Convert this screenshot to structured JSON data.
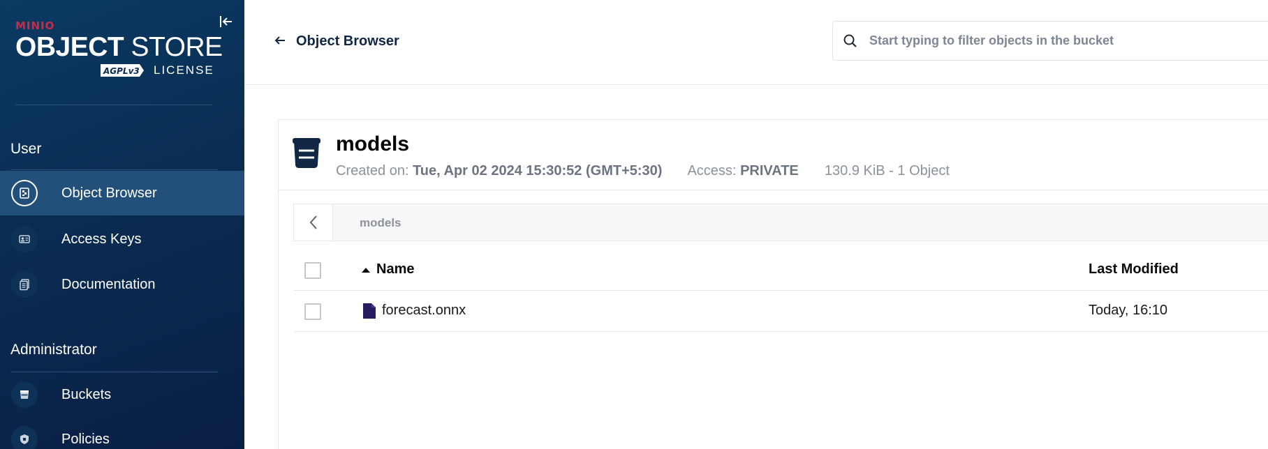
{
  "sidebar": {
    "logo": {
      "brand": "MINIO",
      "title_bold": "OBJECT",
      "title_light": " STORE",
      "badge": "AGPLv3",
      "license": "LICENSE"
    },
    "sections": [
      {
        "title": "User",
        "items": [
          {
            "label": "Object Browser",
            "icon": "object-browser-icon",
            "active": true
          },
          {
            "label": "Access Keys",
            "icon": "access-keys-icon",
            "active": false
          },
          {
            "label": "Documentation",
            "icon": "documentation-icon",
            "active": false
          }
        ]
      },
      {
        "title": "Administrator",
        "items": [
          {
            "label": "Buckets",
            "icon": "buckets-icon",
            "active": false
          },
          {
            "label": "Policies",
            "icon": "policies-icon",
            "active": false
          }
        ]
      }
    ]
  },
  "header": {
    "back_label": "Object Browser",
    "search_placeholder": "Start typing to filter objects in the bucket"
  },
  "bucket": {
    "name": "models",
    "created_label": "Created on:",
    "created_value": "Tue, Apr 02 2024 15:30:52 (GMT+5:30)",
    "access_label": "Access:",
    "access_value": "PRIVATE",
    "size_summary": "130.9 KiB - 1 Object"
  },
  "breadcrumb": {
    "path": "models"
  },
  "table": {
    "columns": {
      "name": "Name",
      "last_modified": "Last Modified"
    },
    "rows": [
      {
        "name": "forecast.onnx",
        "last_modified": "Today, 16:10"
      }
    ]
  },
  "colors": {
    "sidebar_bg": "#0a2c52",
    "sidebar_active": "#23507a",
    "brand_red": "#c72c48",
    "file_icon": "#2a1a5e"
  }
}
